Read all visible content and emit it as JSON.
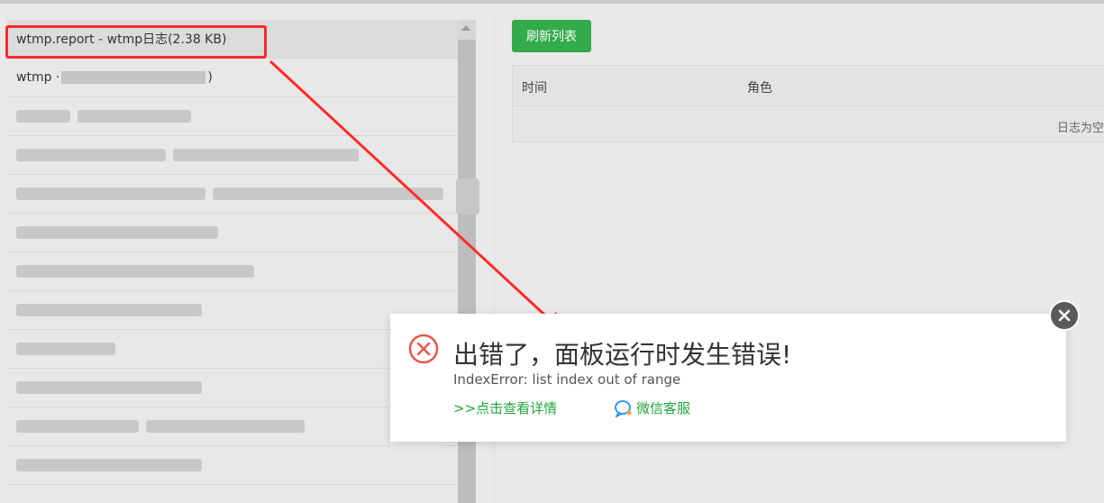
{
  "log_list": {
    "items": [
      {
        "label": "wtmp.report - wtmp日志(2.38 KB)",
        "selected": true
      },
      {
        "prefix": "wtmp · ",
        "suffix": ")"
      }
    ]
  },
  "toolbar": {
    "refresh_label": "刷新列表"
  },
  "table": {
    "headers": {
      "time": "时间",
      "role": "角色"
    },
    "empty_text": "日志为空"
  },
  "error_dialog": {
    "title": "出错了，面板运行时发生错误!",
    "detail": "IndexError: list index out of range",
    "details_link": ">>点击查看详情",
    "support_link": "微信客服"
  },
  "colors": {
    "accent": "#20a53a",
    "annotation": "#ff2a2a",
    "error": "#e5574b"
  }
}
